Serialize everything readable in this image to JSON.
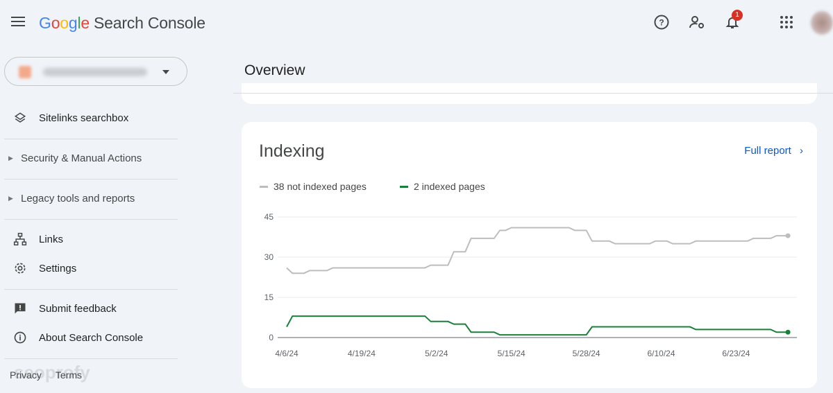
{
  "header": {
    "logo_google": "Google",
    "logo_product": "Search Console",
    "notification_count": "1",
    "icons": [
      "menu-icon",
      "help-icon",
      "manage-users-icon",
      "notifications-icon",
      "apps-icon"
    ]
  },
  "sidebar": {
    "items": [
      {
        "label": "Sitelinks searchbox",
        "icon": "layers-icon"
      },
      {
        "label": "Security & Manual Actions",
        "type": "section"
      },
      {
        "label": "Legacy tools and reports",
        "type": "section"
      },
      {
        "label": "Links",
        "icon": "sitemap-icon"
      },
      {
        "label": "Settings",
        "icon": "gear-icon"
      },
      {
        "label": "Submit feedback",
        "icon": "feedback-icon"
      },
      {
        "label": "About Search Console",
        "icon": "info-icon"
      }
    ],
    "footer": {
      "privacy": "Privacy",
      "terms": "Terms"
    },
    "watermark": "seoprofy"
  },
  "main": {
    "title": "Overview",
    "card": {
      "title": "Indexing",
      "full_report": "Full report"
    }
  },
  "colors": {
    "not_indexed": "#bdbdbd",
    "indexed": "#188038",
    "link": "#0b57d0"
  },
  "chart_data": {
    "type": "line",
    "ylim": [
      0,
      45
    ],
    "yticks": [
      0,
      15,
      30,
      45
    ],
    "xtick_labels": [
      "4/6/24",
      "4/19/24",
      "5/2/24",
      "5/15/24",
      "5/28/24",
      "6/10/24",
      "6/23/24"
    ],
    "grid": true,
    "legend_position": "top-left",
    "x": [
      "4/6/24",
      "4/7/24",
      "4/8/24",
      "4/9/24",
      "4/10/24",
      "4/11/24",
      "4/12/24",
      "4/13/24",
      "4/14/24",
      "4/15/24",
      "4/16/24",
      "4/17/24",
      "4/18/24",
      "4/19/24",
      "4/20/24",
      "4/21/24",
      "4/22/24",
      "4/23/24",
      "4/24/24",
      "4/25/24",
      "4/26/24",
      "4/27/24",
      "4/28/24",
      "4/29/24",
      "4/30/24",
      "5/1/24",
      "5/2/24",
      "5/3/24",
      "5/4/24",
      "5/5/24",
      "5/6/24",
      "5/7/24",
      "5/8/24",
      "5/9/24",
      "5/10/24",
      "5/11/24",
      "5/12/24",
      "5/13/24",
      "5/14/24",
      "5/15/24",
      "5/16/24",
      "5/17/24",
      "5/18/24",
      "5/19/24",
      "5/20/24",
      "5/21/24",
      "5/22/24",
      "5/23/24",
      "5/24/24",
      "5/25/24",
      "5/26/24",
      "5/27/24",
      "5/28/24",
      "5/29/24",
      "5/30/24",
      "5/31/24",
      "6/1/24",
      "6/2/24",
      "6/3/24",
      "6/4/24",
      "6/5/24",
      "6/6/24",
      "6/7/24",
      "6/8/24",
      "6/9/24",
      "6/10/24",
      "6/11/24",
      "6/12/24",
      "6/13/24",
      "6/14/24",
      "6/15/24",
      "6/16/24",
      "6/17/24",
      "6/18/24",
      "6/19/24",
      "6/20/24",
      "6/21/24",
      "6/22/24",
      "6/23/24",
      "6/24/24",
      "6/25/24",
      "6/26/24",
      "6/27/24",
      "6/28/24",
      "6/29/24",
      "6/30/24",
      "7/1/24",
      "7/2/24"
    ],
    "series": [
      {
        "name": "38 not indexed pages",
        "color": "#bdbdbd",
        "values": [
          26,
          24,
          24,
          24,
          25,
          25,
          25,
          25,
          26,
          26,
          26,
          26,
          26,
          26,
          26,
          26,
          26,
          26,
          26,
          26,
          26,
          26,
          26,
          26,
          26,
          27,
          27,
          27,
          27,
          32,
          32,
          32,
          37,
          37,
          37,
          37,
          37,
          40,
          40,
          41,
          41,
          41,
          41,
          41,
          41,
          41,
          41,
          41,
          41,
          41,
          40,
          40,
          40,
          36,
          36,
          36,
          36,
          35,
          35,
          35,
          35,
          35,
          35,
          35,
          36,
          36,
          36,
          35,
          35,
          35,
          35,
          36,
          36,
          36,
          36,
          36,
          36,
          36,
          36,
          36,
          36,
          37,
          37,
          37,
          37,
          38,
          38,
          38
        ]
      },
      {
        "name": "2 indexed pages",
        "color": "#188038",
        "values": [
          4,
          8,
          8,
          8,
          8,
          8,
          8,
          8,
          8,
          8,
          8,
          8,
          8,
          8,
          8,
          8,
          8,
          8,
          8,
          8,
          8,
          8,
          8,
          8,
          8,
          6,
          6,
          6,
          6,
          5,
          5,
          5,
          2,
          2,
          2,
          2,
          2,
          1,
          1,
          1,
          1,
          1,
          1,
          1,
          1,
          1,
          1,
          1,
          1,
          1,
          1,
          1,
          1,
          4,
          4,
          4,
          4,
          4,
          4,
          4,
          4,
          4,
          4,
          4,
          4,
          4,
          4,
          4,
          4,
          4,
          4,
          3,
          3,
          3,
          3,
          3,
          3,
          3,
          3,
          3,
          3,
          3,
          3,
          3,
          3,
          2,
          2,
          2
        ]
      }
    ]
  }
}
